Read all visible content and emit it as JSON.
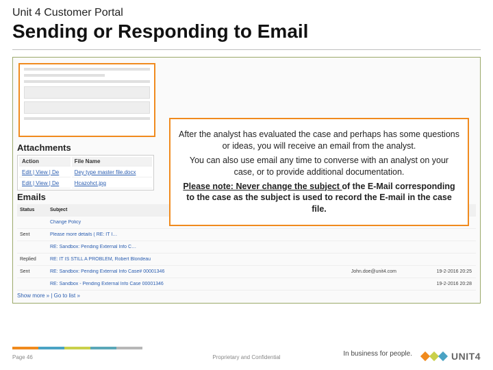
{
  "header": {
    "supertitle": "Unit 4 Customer Portal",
    "title": "Sending or Responding to Email"
  },
  "callout": {
    "p1": "After the analyst has evaluated the case and perhaps has some questions or ideas, you will receive an email from the analyst.",
    "p2": "You can also use email any time to converse with an analyst on your case, or to provide additional documentation.",
    "note_lead": "Please note: ",
    "note_underline": "Never change the subject ",
    "note_rest": "of the E-Mail corresponding to the case as the subject is used to record the E-mail in the case file."
  },
  "attachments": {
    "heading": "Attachments",
    "cols": {
      "action": "Action",
      "file": "File Name"
    },
    "rows": [
      {
        "actions": "Edit | View | De",
        "file": "Dey type master file.docx"
      },
      {
        "actions": "Edit | View | De",
        "file": "Hcazohct.jpg"
      }
    ]
  },
  "emails": {
    "heading": "Emails",
    "header": {
      "status": "Status",
      "subject": "Subject",
      "addr": "",
      "date": ""
    },
    "rows": [
      {
        "status": "",
        "subject": "Change Policy",
        "addr": "",
        "date": ""
      },
      {
        "status": "Sent",
        "subject": "Please more details ( RE: IT I…",
        "addr": "",
        "date": ""
      },
      {
        "status": "",
        "subject": "RE: Sandbox: Pending External Info C…",
        "addr": "",
        "date": ""
      },
      {
        "status": "Replied",
        "subject": "RE: IT IS STILL A PROBLEM, Robert Blondeau",
        "addr": "",
        "date": ""
      },
      {
        "status": "Sent",
        "subject": "RE: Sandbox: Pending External Info Case# 00001346",
        "addr": "John.doe@unit4.com",
        "date": "19-2-2016 20:25"
      },
      {
        "status": "",
        "subject": "RE: Sandbox - Pending External Info Case 00001346",
        "addr": "",
        "date": "19-2-2016 20:28"
      }
    ],
    "showmore": "Show more » | Go to list »"
  },
  "footer": {
    "page": "Page 46",
    "confidential": "Proprietary and Confidential",
    "tagline": "In business for people.",
    "logo": "UNIT4"
  }
}
